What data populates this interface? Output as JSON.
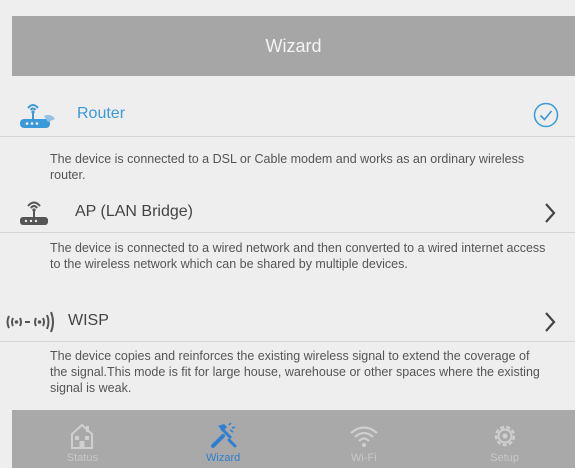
{
  "header": {
    "title": "Wizard"
  },
  "modes": [
    {
      "label": "Router",
      "description": "The device is connected to a DSL or Cable modem and works as an ordinary wireless router.",
      "icon": "router-icon",
      "selected": true
    },
    {
      "label": "AP (LAN Bridge)",
      "description": "The device is connected to a wired network and then converted to a wired internet access to the wireless network which can be shared by multiple devices.",
      "icon": "ap-icon",
      "selected": false
    },
    {
      "label": "WISP",
      "description": "The device copies and reinforces the existing wireless signal to extend the coverage of the signal.This mode is fit for large house, warehouse or other spaces where the existing signal is weak.",
      "icon": "wisp-icon",
      "selected": false
    }
  ],
  "tabs": [
    {
      "label": "Status",
      "icon": "house-icon",
      "active": false
    },
    {
      "label": "Wizard",
      "icon": "wizard-tools-icon",
      "active": true
    },
    {
      "label": "Wi-Fi",
      "icon": "wifi-icon",
      "active": false
    },
    {
      "label": "Setup",
      "icon": "gear-icon",
      "active": false
    }
  ],
  "colors": {
    "accent": "#3a9ad9",
    "header_bg": "#a6a6a6",
    "tabbar_bg": "#a9a9a9",
    "active_tab": "#2f7fd0",
    "page_bg": "#eeeeee"
  }
}
